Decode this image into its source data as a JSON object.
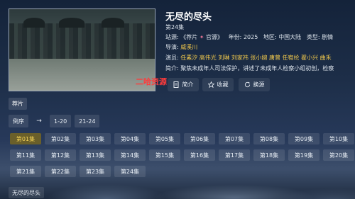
{
  "show": {
    "title": "无尽的尽头",
    "episode_count": "第24集",
    "site_label": "站源:",
    "site_value": "《荐片",
    "site_dot": "✦",
    "site_value2": "官源》",
    "year_label": "年份:",
    "year": "2025",
    "region_label": "地区:",
    "region": "中国大陆",
    "type_label": "类型:",
    "type": "剧情",
    "director_label": "导演:",
    "director": "威溪川",
    "cast_label": "演员:",
    "cast": "任素汐 高伟光 刘琳 刘家祎 张小婉 唐曾 任宥纶 翟小兴 曲禾",
    "intro_label": "简介:",
    "intro": "聚焦未成年人司法保护，讲述了未成年人检察小组初创，检察"
  },
  "watermark": "二哈资源",
  "actions": {
    "intro": "简介",
    "favorite": "收藏",
    "switch_source": "换源"
  },
  "source_tab": "荐片",
  "range": {
    "order": "倒序",
    "arrow": "→",
    "r1": "1-20",
    "r2": "21-24"
  },
  "episodes": [
    "第01集",
    "第02集",
    "第03集",
    "第04集",
    "第05集",
    "第06集",
    "第07集",
    "第08集",
    "第09集",
    "第10集",
    "第11集",
    "第12集",
    "第13集",
    "第14集",
    "第15集",
    "第16集",
    "第17集",
    "第18集",
    "第19集",
    "第20集",
    "第21集",
    "第22集",
    "第23集",
    "第24集"
  ],
  "bottom_label": "无尽的尽头",
  "colors": {
    "accent": "#f6d458",
    "watermark": "#ff3b3b"
  }
}
